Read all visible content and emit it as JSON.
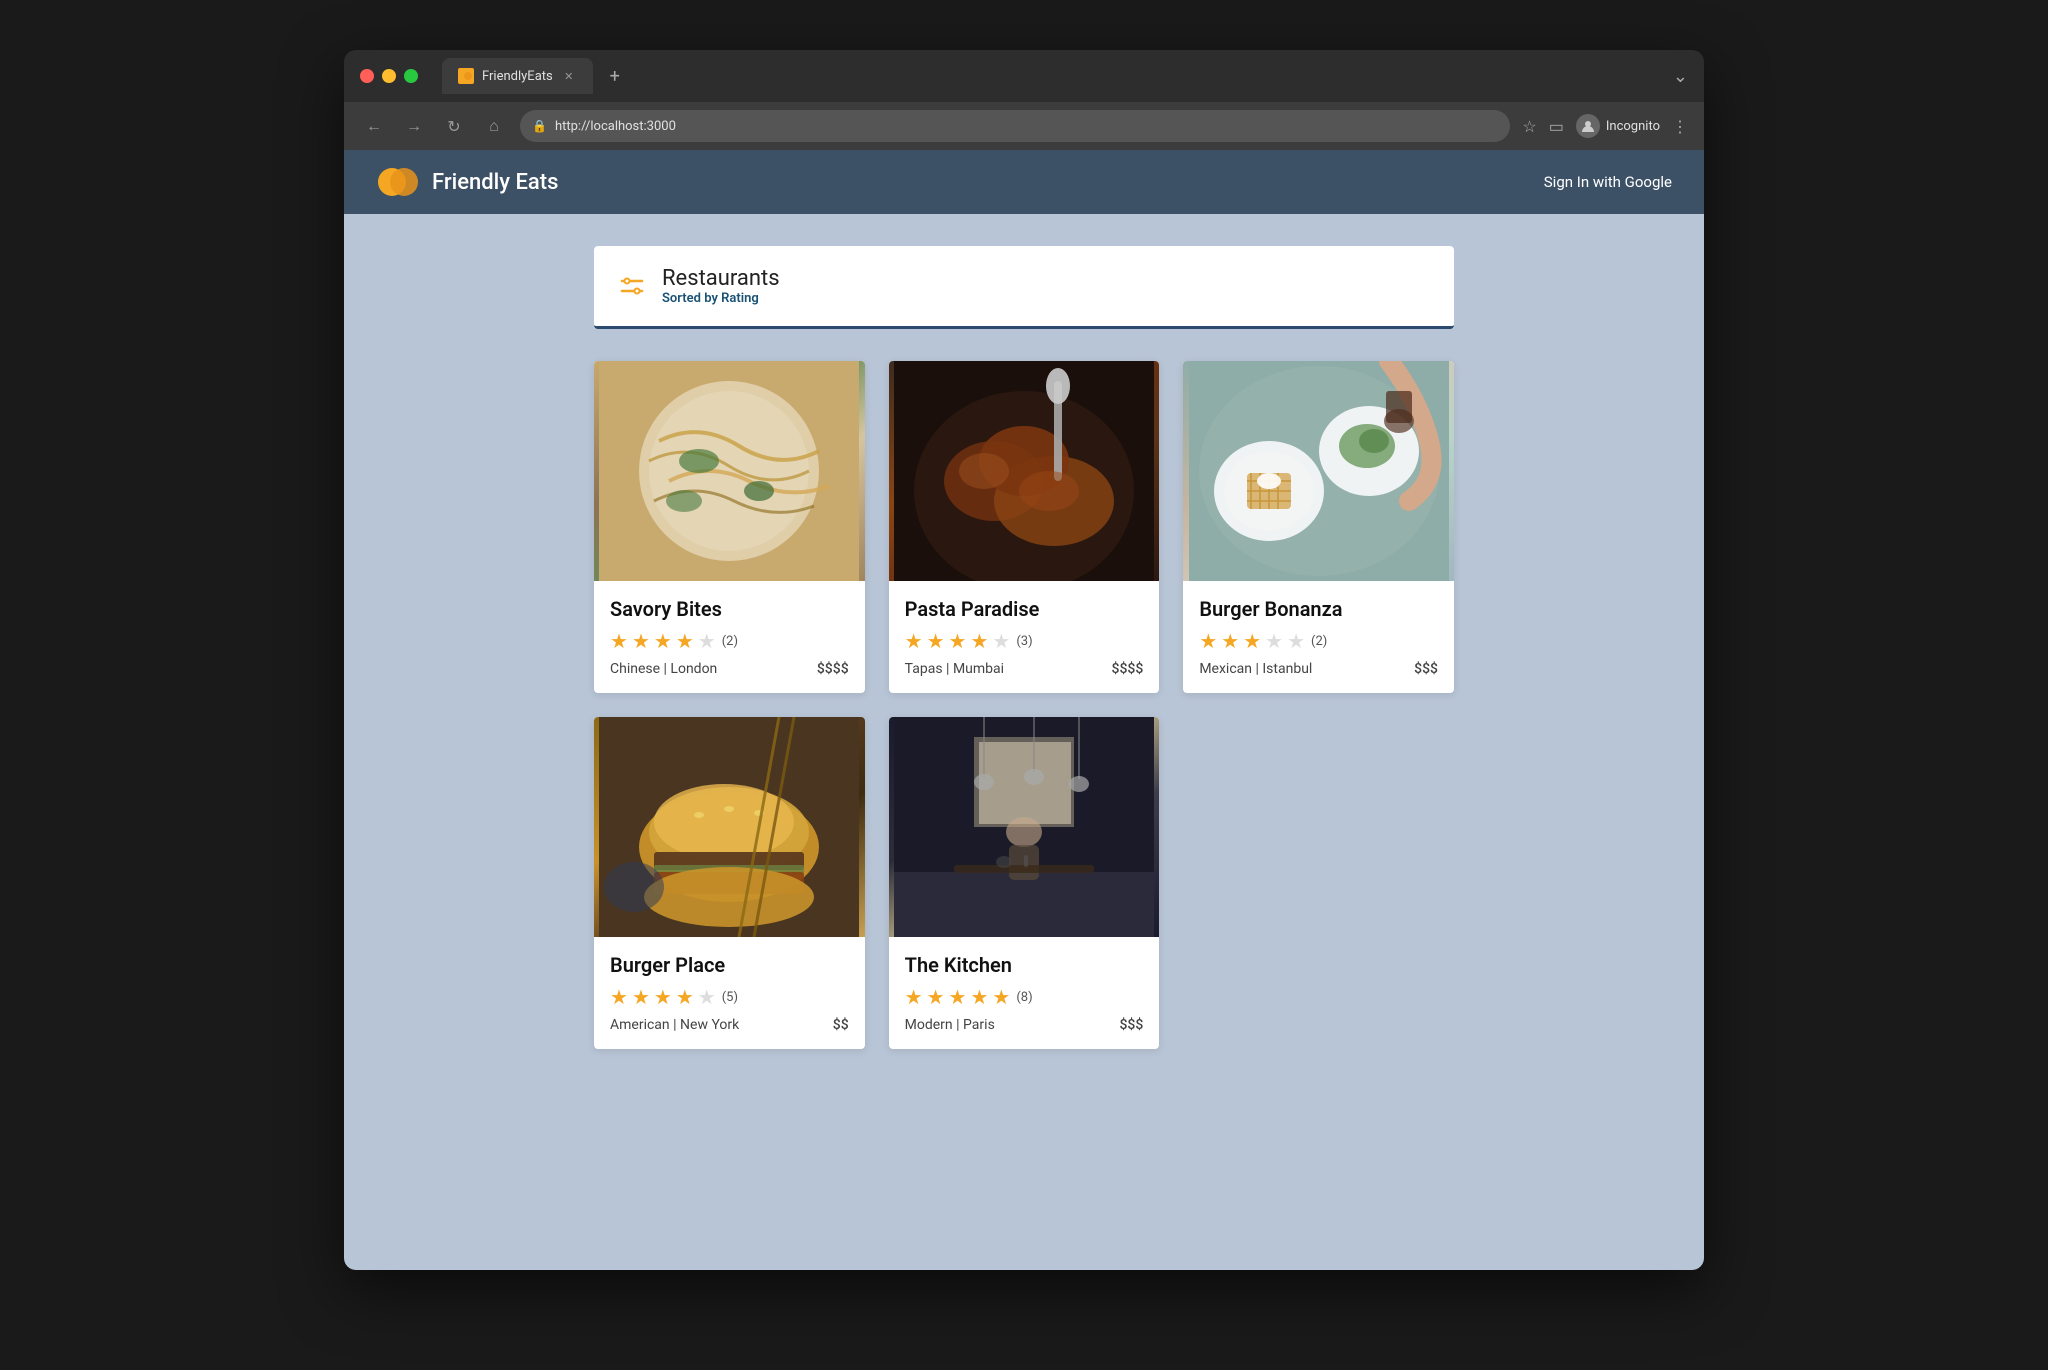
{
  "browser": {
    "tab_title": "FriendlyEats",
    "url": "http://localhost:3000",
    "new_tab_label": "+",
    "more_label": "⌄",
    "incognito_label": "Incognito",
    "more_options_label": "⋮"
  },
  "header": {
    "app_title": "Friendly Eats",
    "sign_in_label": "Sign In with Google"
  },
  "restaurants_section": {
    "title": "Restaurants",
    "sort_label": "Sorted by Rating"
  },
  "restaurants": [
    {
      "name": "Savory Bites",
      "rating": 3.5,
      "filled_stars": 3,
      "half_star": true,
      "empty_stars": 1,
      "review_count": "(2)",
      "cuisine": "Chinese",
      "location": "London",
      "price": "$$$$",
      "img_class": "food-img-1"
    },
    {
      "name": "Pasta Paradise",
      "rating": 3.5,
      "filled_stars": 3,
      "half_star": true,
      "empty_stars": 1,
      "review_count": "(3)",
      "cuisine": "Tapas",
      "location": "Mumbai",
      "price": "$$$$",
      "img_class": "food-img-2"
    },
    {
      "name": "Burger Bonanza",
      "rating": 3.0,
      "filled_stars": 3,
      "half_star": false,
      "empty_stars": 2,
      "review_count": "(2)",
      "cuisine": "Mexican",
      "location": "Istanbul",
      "price": "$$$",
      "img_class": "food-img-3"
    },
    {
      "name": "Burger Place",
      "rating": 4.0,
      "filled_stars": 4,
      "half_star": false,
      "empty_stars": 1,
      "review_count": "(5)",
      "cuisine": "American",
      "location": "New York",
      "price": "$$",
      "img_class": "food-img-4"
    },
    {
      "name": "The Kitchen",
      "rating": 4.5,
      "filled_stars": 4,
      "half_star": true,
      "empty_stars": 0,
      "review_count": "(8)",
      "cuisine": "Modern",
      "location": "Paris",
      "price": "$$$",
      "img_class": "food-img-5"
    }
  ]
}
